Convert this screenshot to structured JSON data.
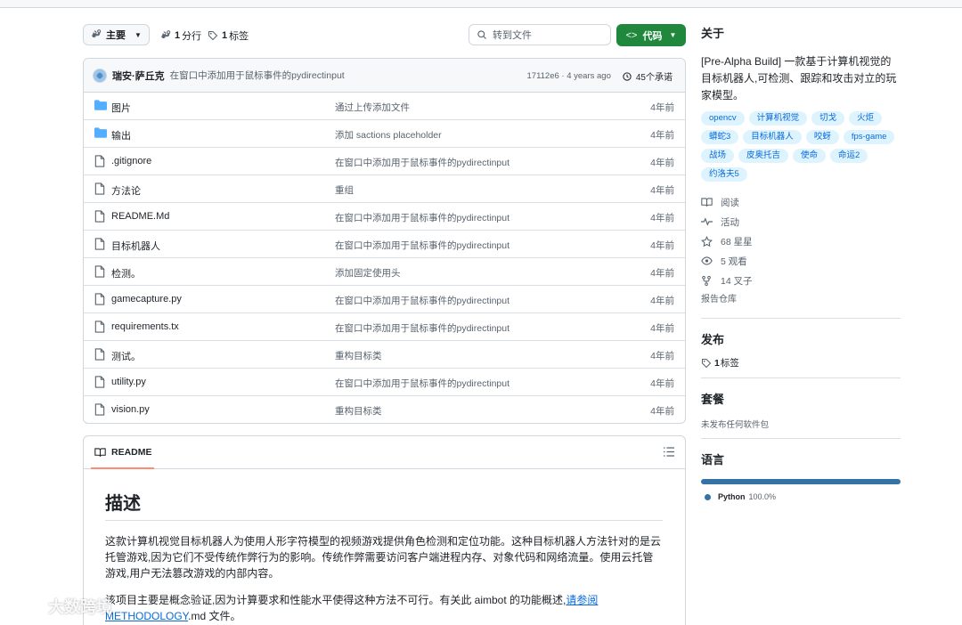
{
  "toolbar": {
    "branch_label": "主要",
    "branches_count": "1",
    "branches_label": "分行",
    "tags_count": "1",
    "tags_label": "标签",
    "search_placeholder": "转到文件",
    "code_label": "代码"
  },
  "commit": {
    "author": "瑞安·萨丘克",
    "message": "在窗口中添加用于鼠标事件的pydirectinput",
    "hash_time": "17112e6 · 4 years ago",
    "commits_label": "45个承诺"
  },
  "files": [
    {
      "type": "folder",
      "name": "图片",
      "message": "通过上传添加文件",
      "age": "4年前"
    },
    {
      "type": "folder",
      "name": "输出",
      "message": "添加 sactions placeholder",
      "age": "4年前"
    },
    {
      "type": "file",
      "name": ".gitignore",
      "message": "在窗口中添加用于鼠标事件的pydirectinput",
      "age": "4年前"
    },
    {
      "type": "file",
      "name": "方法论",
      "message": "重组",
      "age": "4年前"
    },
    {
      "type": "file",
      "name": "README.Md",
      "message": "在窗口中添加用于鼠标事件的pydirectinput",
      "age": "4年前"
    },
    {
      "type": "file",
      "name": "目标机器人",
      "message": "在窗口中添加用于鼠标事件的pydirectinput",
      "age": "4年前"
    },
    {
      "type": "file",
      "name": "检测。",
      "message": "添加固定使用头",
      "age": "4年前"
    },
    {
      "type": "file",
      "name": "gamecapture.py",
      "message": "在窗口中添加用于鼠标事件的pydirectinput",
      "age": "4年前"
    },
    {
      "type": "file",
      "name": "requirements.tx",
      "message": "在窗口中添加用于鼠标事件的pydirectinput",
      "age": "4年前"
    },
    {
      "type": "file",
      "name": "测试。",
      "message": "重构目标类",
      "age": "4年前"
    },
    {
      "type": "file",
      "name": "utility.py",
      "message": "在窗口中添加用于鼠标事件的pydirectinput",
      "age": "4年前"
    },
    {
      "type": "file",
      "name": "vision.py",
      "message": "重构目标类",
      "age": "4年前"
    }
  ],
  "readme": {
    "tab_label": "README",
    "heading": "描述",
    "para1": "这款计算机视觉目标机器人为使用人形字符模型的视频游戏提供角色检测和定位功能。这种目标机器人方法针对的是云托管游戏,因为它们不受传统作弊行为的影响。传统作弊需要访问客户端进程内存、对象代码和网络流量。使用云托管游戏,用户无法篡改游戏的内部内容。",
    "para2_text": "该项目主要是概念验证,因为计算要求和性能水平使得这种方法不可行。有关此 aimbot 的功能概述,",
    "para2_link1": "请参阅",
    "para2_link2": "METHODOLOGY",
    "para2_tail": ".md 文件。"
  },
  "sidebar": {
    "about_title": "关于",
    "description": "[Pre-Alpha Build] 一款基于计算机视觉的目标机器人,可检测、跟踪和攻击对立的玩家模型。",
    "topics": [
      "opencv",
      "计算机视觉",
      "切戈",
      "火炬",
      "蟒蛇3",
      "目标机器人",
      "咬蚜",
      "fps-game",
      "战场",
      "皮奥托吉",
      "使命",
      "命运2",
      "约洛夫5"
    ],
    "links": {
      "readme": "阅读",
      "activity": "活动",
      "stars": "68 星星",
      "watchers": "5 观看",
      "forks": "14 叉子"
    },
    "report": "报告仓库",
    "releases_title": "发布",
    "releases_count": "1",
    "releases_label": "标签",
    "packages_title": "套餐",
    "packages_note": "未发布任何软件包",
    "languages_title": "语言",
    "language_name": "Python",
    "language_pct": "100.0%"
  },
  "watermark": "大数跨境",
  "colors": {
    "accent_green": "#1f883d",
    "link_blue": "#0969da",
    "python": "#3572A5",
    "folder": "#54aeff"
  }
}
